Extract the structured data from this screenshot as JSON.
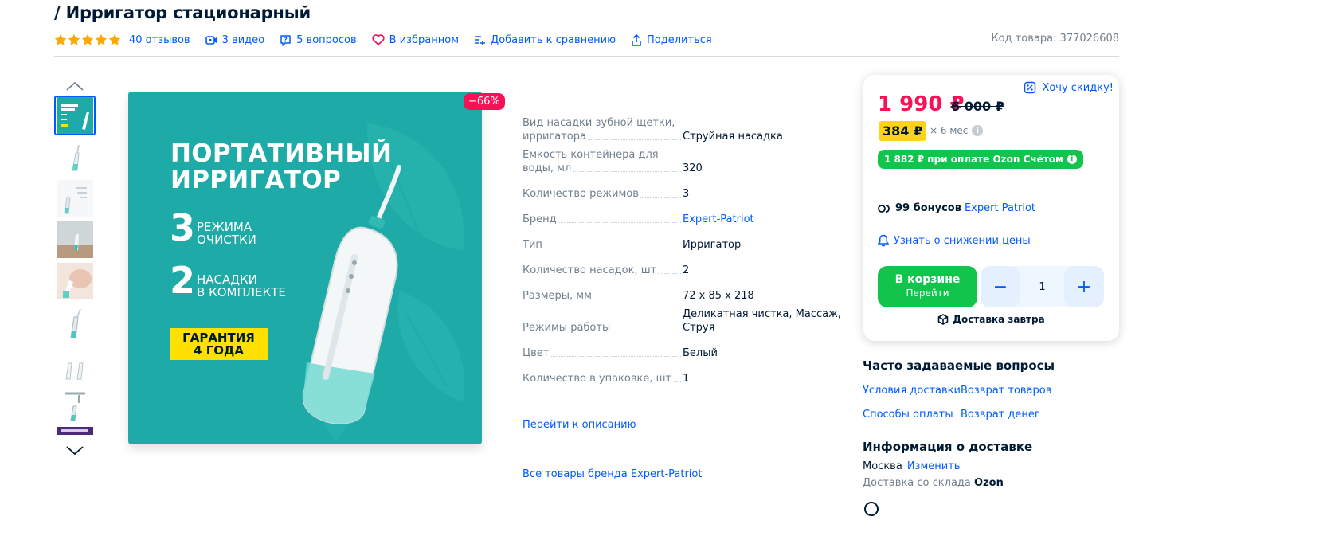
{
  "product": {
    "title": "/ Ирригатор стационарный",
    "code": "Код товара: 377026608"
  },
  "meta": {
    "rating_stars": 5,
    "reviews": "40 отзывов",
    "videos": "3 видео",
    "questions": "5 вопросов",
    "favorite": "В избранном",
    "compare": "Добавить к сравнению",
    "share": "Поделиться"
  },
  "gallery": {
    "discount_badge": "−66%",
    "promo": {
      "title_line1": "ПОРТАТИВНЫЙ",
      "title_line2": "ИРРИГАТОР",
      "num1": "3",
      "txt1_line1": "РЕЖИМА",
      "txt1_line2": "ОЧИСТКИ",
      "num2": "2",
      "txt2_line1": "НАСАДКИ",
      "txt2_line2": "В КОМПЛЕКТЕ",
      "guarantee_line1": "ГАРАНТИЯ",
      "guarantee_line2": "4 ГОДА"
    },
    "thumb_count": 9,
    "active_thumb": 0
  },
  "specs": [
    {
      "label": "Вид насадки зубной щетки, ирригатора",
      "value": "Струйная насадка",
      "link": false
    },
    {
      "label": "Емкость контейнера для воды, мл",
      "value": "320",
      "link": false
    },
    {
      "label": "Количество режимов",
      "value": "3",
      "link": false
    },
    {
      "label": "Бренд",
      "value": "Expert-Patriot",
      "link": true
    },
    {
      "label": "Тип",
      "value": "Ирригатор",
      "link": false
    },
    {
      "label": "Количество насадок, шт",
      "value": "2",
      "link": false
    },
    {
      "label": "Размеры, мм",
      "value": "72 x 85 x 218",
      "link": false
    },
    {
      "label": "Режимы работы",
      "value": "Деликатная чистка, Массаж, Струя",
      "link": false
    },
    {
      "label": "Цвет",
      "value": "Белый",
      "link": false
    },
    {
      "label": "Количество в упаковке, шт",
      "value": "1",
      "link": false
    }
  ],
  "links": {
    "to_description": "Перейти к описанию",
    "all_brand": "Все товары бренда Expert-Patriot"
  },
  "price_card": {
    "want_discount": "Хочу скидку!",
    "price": "1 990 ₽",
    "old_price": "6 000 ₽",
    "installment": "384 ₽",
    "installment_term": "× 6 мес",
    "ozon_card": "1 882 ₽ при оплате Ozon Счётом",
    "bonus_count": "99 бонусов",
    "bonus_seller": "Expert Patriot",
    "notify": "Узнать о снижении цены",
    "cart_line1": "В корзине",
    "cart_line2": "Перейти",
    "quantity": "1",
    "minus": "−",
    "plus": "+",
    "delivery": "Доставка завтра"
  },
  "faq": {
    "title": "Часто задаваемые вопросы",
    "links": [
      "Условия доставки",
      "Возврат товаров",
      "Способы оплаты",
      "Возврат денег"
    ]
  },
  "delivery_info": {
    "title": "Информация о доставке",
    "city": "Москва",
    "change": "Изменить",
    "warehouse_prefix": "Доставка со склада",
    "warehouse": "Ozon"
  },
  "colors": {
    "accent": "#005bff",
    "price": "#f91155",
    "green": "#10c44c",
    "teal": "#1eaaa6",
    "yellow": "#ffd21f"
  }
}
